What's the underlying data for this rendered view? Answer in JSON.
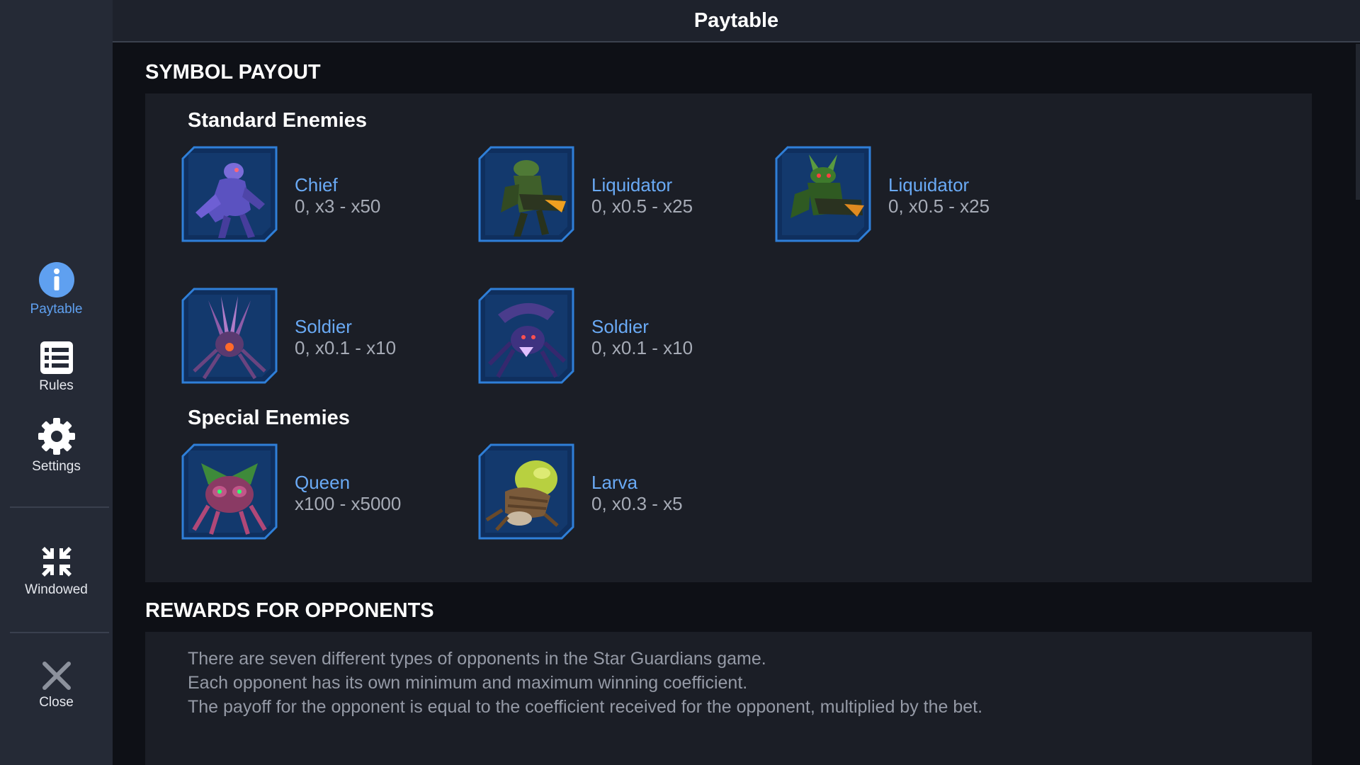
{
  "header": {
    "title": "Paytable"
  },
  "sidebar": {
    "paytable": "Paytable",
    "rules": "Rules",
    "settings": "Settings",
    "windowed": "Windowed",
    "close": "Close"
  },
  "symbol_payout": {
    "title": "SYMBOL PAYOUT",
    "standard_title": "Standard Enemies",
    "special_title": "Special Enemies",
    "standard": [
      {
        "name": "Chief",
        "payout": "0, x3 - x50"
      },
      {
        "name": "Liquidator",
        "payout": "0, x0.5 - x25"
      },
      {
        "name": "Liquidator",
        "payout": "0, x0.5 - x25"
      },
      {
        "name": "Soldier",
        "payout": "0, x0.1 - x10"
      },
      {
        "name": "Soldier",
        "payout": "0, x0.1 - x10"
      }
    ],
    "special": [
      {
        "name": "Queen",
        "payout": "x100 - x5000"
      },
      {
        "name": "Larva",
        "payout": "0, x0.3 - x5"
      }
    ]
  },
  "rewards": {
    "title": "REWARDS FOR OPPONENTS",
    "lines": [
      "There are seven different types of opponents in the Star Guardians game.",
      "Each opponent has its own minimum and maximum winning coefficient.",
      "The payoff for the opponent is equal to the coefficient received for the opponent, multiplied by the bet."
    ]
  },
  "colors": {
    "accent": "#5fa0f0",
    "name": "#6aaaf5",
    "frame": "#2f7fd8"
  }
}
